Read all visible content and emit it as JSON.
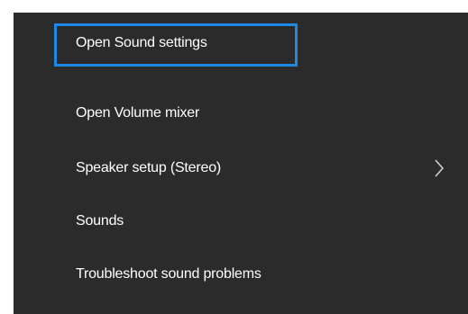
{
  "context_menu": {
    "items": [
      {
        "label": "Open Sound settings",
        "focused": true,
        "submenu": false
      },
      {
        "label": "Open Volume mixer",
        "focused": false,
        "submenu": false
      },
      {
        "label": "Speaker setup (Stereo)",
        "focused": false,
        "submenu": true,
        "submenu_icon": "chevron-right-icon"
      },
      {
        "label": "Sounds",
        "focused": false,
        "submenu": false
      },
      {
        "label": "Troubleshoot sound problems",
        "focused": false,
        "submenu": false
      }
    ],
    "background_color": "#2b2b2b",
    "text_color": "#ffffff",
    "focus_color": "#1e88e5"
  }
}
